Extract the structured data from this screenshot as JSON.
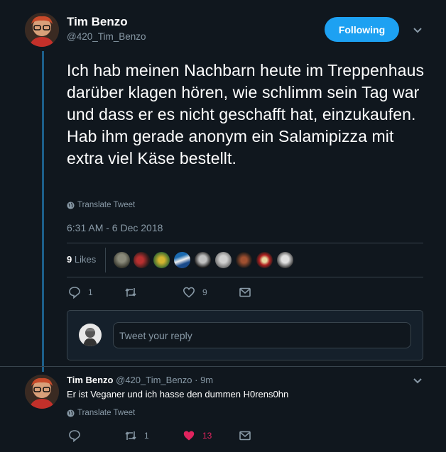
{
  "main_tweet": {
    "name": "Tim Benzo",
    "handle": "@420_Tim_Benzo",
    "follow_label": "Following",
    "text": "Ich hab meinen Nachbarn heute im Treppenhaus darüber klagen hören, wie schlimm sein Tag war und dass er es nicht geschafft hat, einzukaufen. Hab ihm gerade anonym ein Salamipizza mit extra viel Käse bestellt.",
    "translate_label": "Translate Tweet",
    "timestamp": "6:31 AM - 6 Dec 2018",
    "likes_count": "9",
    "likes_label": "Likes",
    "liker_count": 9,
    "actions": {
      "reply_count": "1",
      "retweet_count": "",
      "like_count": "9"
    }
  },
  "reply_composer": {
    "placeholder": "Tweet your reply"
  },
  "reply_tweet": {
    "name": "Tim Benzo",
    "handle": "@420_Tim_Benzo",
    "time": "· 9m",
    "text": "Er ist Veganer und ich hasse den dummen H0rens0hn",
    "translate_label": "Translate Tweet",
    "actions": {
      "reply_count": "",
      "retweet_count": "1",
      "like_count": "13"
    }
  },
  "colors": {
    "background": "#10171e",
    "accent": "#1da1f2",
    "muted": "#8899a6",
    "like_active": "#e0245e",
    "thread_line": "#1c5f8a"
  }
}
